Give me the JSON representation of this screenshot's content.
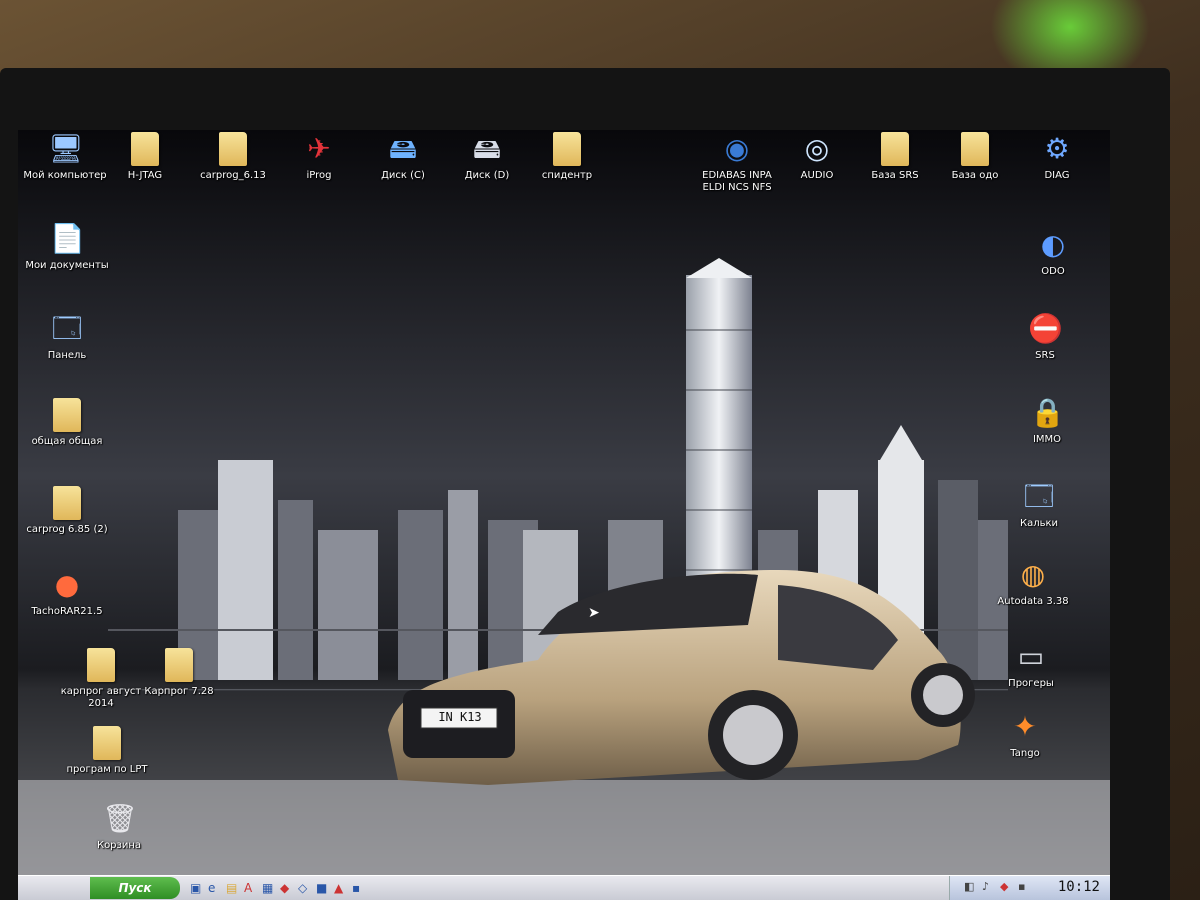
{
  "desktop": {
    "icons_top": [
      {
        "label": "Мой компьютер",
        "icon": "computer-icon"
      },
      {
        "label": "H-JTAG",
        "icon": "folder-icon"
      },
      {
        "label": "carprog_6.13",
        "icon": "folder-icon"
      },
      {
        "label": "iProg",
        "icon": "iprog-icon"
      },
      {
        "label": "Диск (C)",
        "icon": "drive-icon"
      },
      {
        "label": "Диск (D)",
        "icon": "drive-icon"
      },
      {
        "label": "спидентр",
        "icon": "folder-icon"
      },
      {
        "label": "EDIABAS INPA ELDI NCS NFS",
        "icon": "bmw-icon"
      },
      {
        "label": "AUDIO",
        "icon": "audio-icon"
      },
      {
        "label": "База SRS",
        "icon": "folder-icon"
      },
      {
        "label": "База одо",
        "icon": "folder-icon"
      },
      {
        "label": "DIAG",
        "icon": "diag-icon"
      }
    ],
    "icons_left": [
      {
        "label": "Мои документы",
        "icon": "documents-icon"
      },
      {
        "label": "Панель",
        "icon": "control-panel-icon"
      },
      {
        "label": "общая общая",
        "icon": "folder-icon"
      },
      {
        "label": "carprog 6.85 (2)",
        "icon": "folder-icon"
      },
      {
        "label": "TachoRAR21.5",
        "icon": "tacho-icon"
      },
      {
        "label": "карпрог август 2014",
        "icon": "folder-icon"
      },
      {
        "label": "Карпрог 7.28",
        "icon": "folder-icon"
      },
      {
        "label": "програм по LPT",
        "icon": "folder-icon"
      },
      {
        "label": "Корзина",
        "icon": "recycle-bin-icon"
      }
    ],
    "icons_right": [
      {
        "label": "ODO",
        "icon": "odo-icon"
      },
      {
        "label": "SRS",
        "icon": "srs-icon"
      },
      {
        "label": "IMMO",
        "icon": "lock-icon"
      },
      {
        "label": "Кальки",
        "icon": "kalki-icon"
      },
      {
        "label": "Autodata 3.38",
        "icon": "autodata-icon"
      },
      {
        "label": "Прогеры",
        "icon": "programmer-icon"
      },
      {
        "label": "Tango",
        "icon": "tango-icon"
      }
    ],
    "license_plate": "IN K13"
  },
  "taskbar": {
    "start_label": "Пуск",
    "clock": "10:12"
  },
  "colors": {
    "folder": "#e9c66a",
    "taskbar": "#d3d5dd",
    "start": "#3c9a2f"
  }
}
